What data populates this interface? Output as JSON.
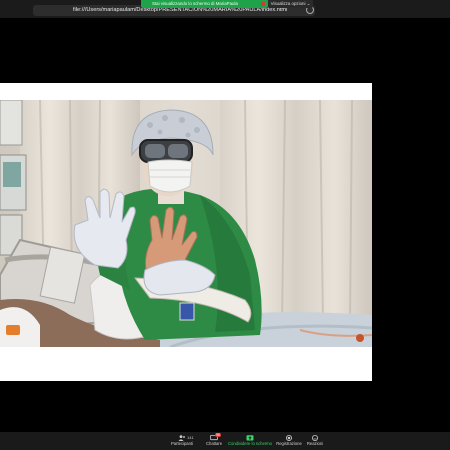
{
  "browser": {
    "url": "file:///Users/mariapaulam/Desktop/PRESENTACION%20MARIA%20PAULA/index.html"
  },
  "share_banner": {
    "text": "Stai visualizzando lo schermo di MariaPaula"
  },
  "view_options": {
    "label": "Visualizza opzioni ⌄"
  },
  "toolbar": {
    "participants": {
      "label": "Partecipanti",
      "count": "141"
    },
    "chat": {
      "label": "Chattare",
      "badge": "98"
    },
    "share": {
      "label": "Condividere lo schermo"
    },
    "record": {
      "label": "Registrazione"
    },
    "reactions": {
      "label": "Reazioni"
    }
  },
  "colors": {
    "share_green": "#39d36a",
    "gown_green": "#2e8b45"
  }
}
